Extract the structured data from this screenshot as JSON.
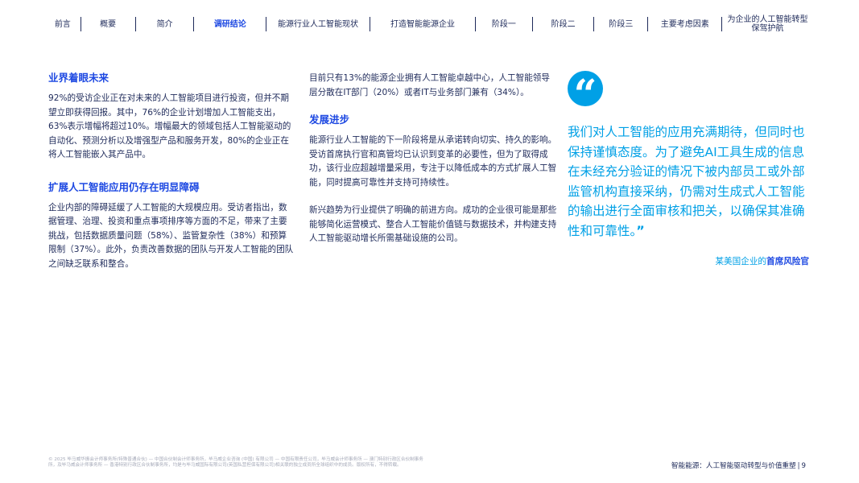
{
  "nav": {
    "items": [
      {
        "label": "前言",
        "active": false
      },
      {
        "label": "概要",
        "active": false
      },
      {
        "label": "简介",
        "active": false
      },
      {
        "label": "调研结论",
        "active": true
      },
      {
        "label": "能源行业人工智能现状",
        "active": false
      },
      {
        "label": "打造智能能源企业",
        "active": false
      },
      {
        "label": "阶段一",
        "active": false
      },
      {
        "label": "阶段二",
        "active": false
      },
      {
        "label": "阶段三",
        "active": false
      },
      {
        "label": "主要考虑因素",
        "active": false
      },
      {
        "label": "为企业的人工智能转型保驾护航",
        "active": false
      }
    ]
  },
  "col1": {
    "heading1": "业界着眼未来",
    "para1": "92%的受访企业正在对未来的人工智能项目进行投资，但并不期望立即获得回报。其中，76%的企业计划增加人工智能支出，63%表示增幅将超过10%。增幅最大的领域包括人工智能驱动的自动化、预测分析以及增强型产品和服务开发，80%的企业正在将人工智能嵌入其产品中。",
    "heading2": "扩展人工智能应用仍存在明显障碍",
    "para2": "企业内部的障碍延缓了人工智能的大规模应用。受访者指出，数据管理、治理、投资和重点事项排序等方面的不足，带来了主要挑战，包括数据质量问题（58%）、监管复杂性（38%）和预算限制（37%）。此外，负责改善数据的团队与开发人工智能的团队之间缺乏联系和整合。"
  },
  "col2": {
    "para1": "目前只有13%的能源企业拥有人工智能卓越中心，人工智能领导层分散在IT部门（20%）或者IT与业务部门兼有（34%）。",
    "heading1": "发展进步",
    "para2": "能源行业人工智能的下一阶段将是从承诺转向切实、持久的影响。受访首席执行官和高管均已认识到变革的必要性，但为了取得成功，该行业应超越增量采用，专注于以降低成本的方式扩展人工智能，同时提高可靠性并支持可持续性。",
    "para3": "新兴趋势为行业提供了明确的前进方向。成功的企业很可能是那些能够简化运营模式、整合人工智能价值链与数据技术，并构建支持人工智能驱动增长所需基础设施的公司。"
  },
  "quote": {
    "icon": "quote-open-icon",
    "text": "我们对人工智能的应用充满期待，但同时也保持谨慎态度。为了避免AI工具生成的信息在未经充分验证的情况下被内部员工或外部监管机构直接采纳，仍需对生成式人工智能的输出进行全面审核和把关，以确保其准确性和可靠性。",
    "close_mark": "”",
    "attribution_prefix": "某美国企业的",
    "attribution_role": "首席风险官"
  },
  "footer": {
    "legal": "© 2025 毕马威华振会计师事务所(特殊普通合伙) — 中国合伙制会计师事务所，毕马威企业咨询 (中国) 有限公司 — 中国有限责任公司，毕马威会计师事务所 — 澳门特别行政区合伙制事务所，及毕马威会计师事务所 — 香港特别行政区合伙制事务所，均是与毕马威国际有限公司(英国私营担保有限公司)相关联的独立成员所全球组织中的成员。版权所有，不得转载。",
    "doc_title": "智能能源：人工智能驱动转型与价值重塑",
    "page_number": "9"
  },
  "colors": {
    "accent_blue": "#1e49e2",
    "quote_cyan": "#00a0e6",
    "text_navy": "#1e2a5a"
  }
}
